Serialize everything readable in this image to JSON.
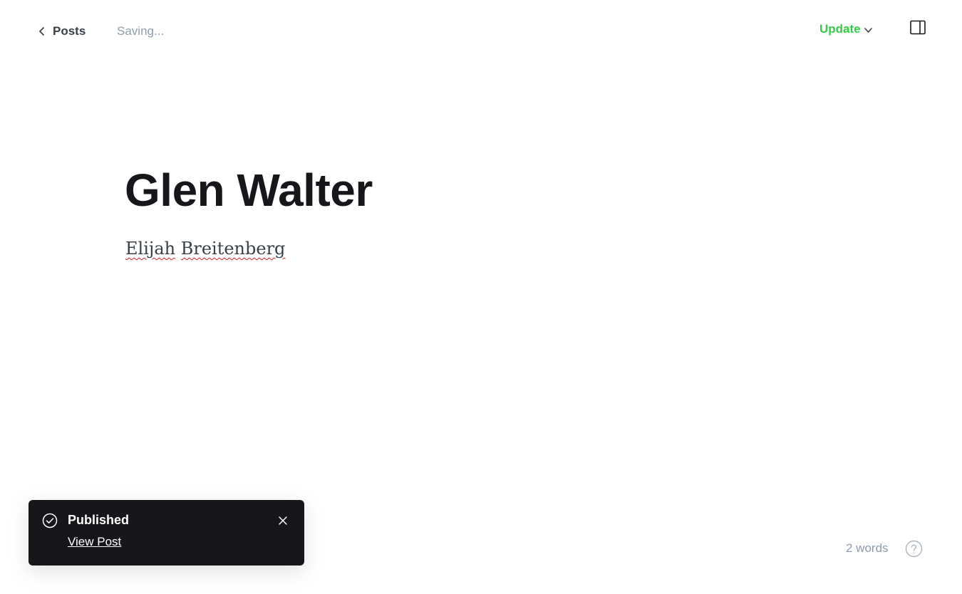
{
  "header": {
    "back_label": "Posts",
    "status_text": "Saving...",
    "update_label": "Update"
  },
  "editor": {
    "title": "Glen Walter",
    "body_words": [
      "Elijah",
      "Breitenberg"
    ]
  },
  "toast": {
    "title": "Published",
    "link_label": "View Post"
  },
  "footer": {
    "word_count": "2 words"
  },
  "colors": {
    "accent_green": "#30cf43",
    "toast_bg": "#15171a",
    "muted_text": "#8e9cac"
  },
  "icons": {
    "back": "chevron-left-icon",
    "update_dropdown": "chevron-down-icon",
    "settings": "sidebar-toggle-icon",
    "toast_status": "check-circle-icon",
    "toast_close": "close-icon",
    "help": "help-circle-icon"
  }
}
